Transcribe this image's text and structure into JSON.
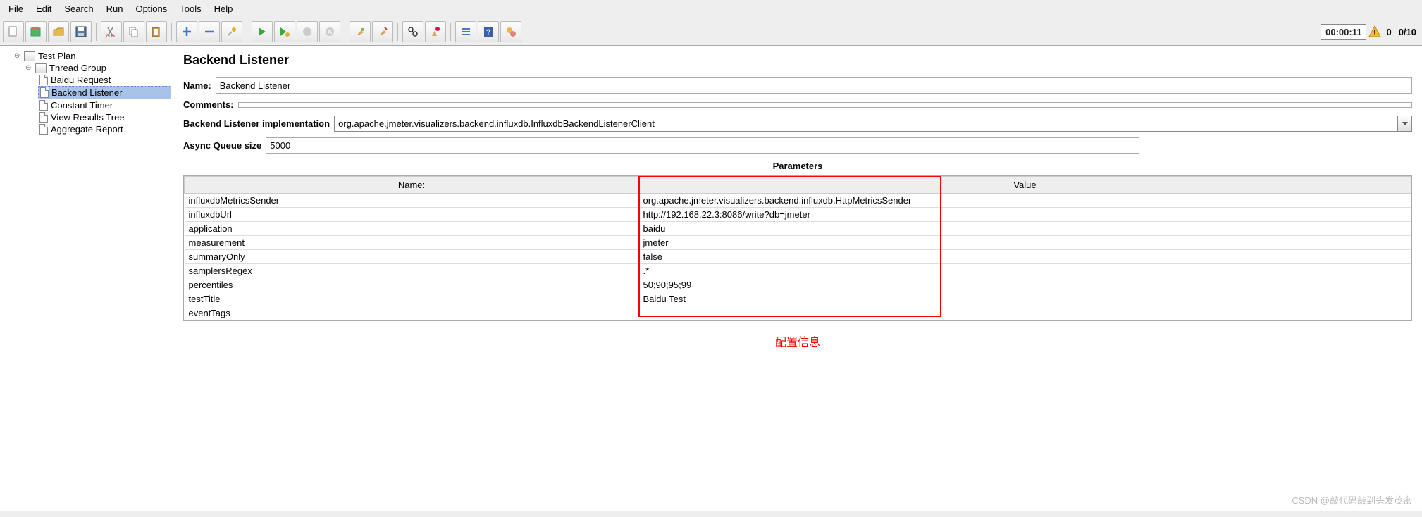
{
  "menu": {
    "file": "File",
    "edit": "Edit",
    "search": "Search",
    "run": "Run",
    "options": "Options",
    "tools": "Tools",
    "help": "Help"
  },
  "status": {
    "timer": "00:00:11",
    "threads": "0",
    "requests": "0/10"
  },
  "tree": {
    "root": "Test Plan",
    "group": "Thread Group",
    "items": [
      "Baidu Request",
      "Backend Listener",
      "Constant Timer",
      "View Results Tree",
      "Aggregate Report"
    ]
  },
  "panel": {
    "title": "Backend Listener",
    "name_label": "Name:",
    "name_value": "Backend Listener",
    "comments_label": "Comments:",
    "comments_value": "",
    "impl_label": "Backend Listener implementation",
    "impl_value": "org.apache.jmeter.visualizers.backend.influxdb.InfluxdbBackendListenerClient",
    "queue_label": "Async Queue size",
    "queue_value": "5000",
    "params_title": "Parameters",
    "col_name": "Name:",
    "col_value": "Value",
    "rows": [
      {
        "n": "influxdbMetricsSender",
        "v": "org.apache.jmeter.visualizers.backend.influxdb.HttpMetricsSender"
      },
      {
        "n": "influxdbUrl",
        "v": "http://192.168.22.3:8086/write?db=jmeter"
      },
      {
        "n": "application",
        "v": "baidu"
      },
      {
        "n": "measurement",
        "v": "jmeter"
      },
      {
        "n": "summaryOnly",
        "v": "false"
      },
      {
        "n": "samplersRegex",
        "v": ".*"
      },
      {
        "n": "percentiles",
        "v": "50;90;95;99"
      },
      {
        "n": "testTitle",
        "v": "Baidu Test"
      },
      {
        "n": "eventTags",
        "v": ""
      }
    ],
    "caption": "配置信息"
  },
  "watermark": "CSDN @敲代码敲到头发茂密"
}
